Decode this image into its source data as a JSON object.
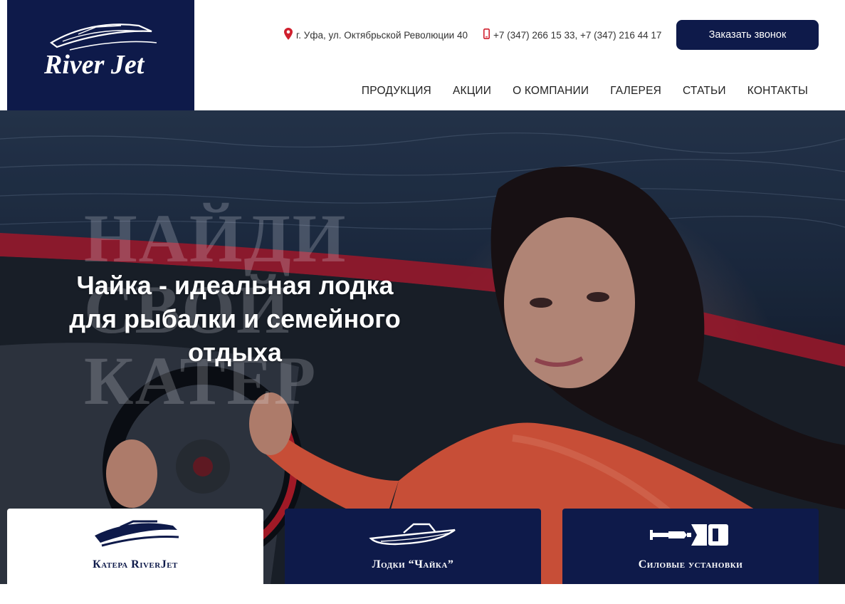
{
  "brand": {
    "name": "River Jet",
    "colors": {
      "navy": "#0e1a4a",
      "accent_red": "#d0202e",
      "white": "#ffffff"
    }
  },
  "header": {
    "address": "г. Уфа, ул. Октябрьской Революции 40",
    "phones": "+7 (347) 266 15 33, +7 (347) 216 44 17",
    "call_button": "Заказать звонок",
    "icons": {
      "address": "map-pin-icon",
      "phone": "phone-icon"
    }
  },
  "nav": {
    "items": [
      {
        "label": "ПРОДУКЦИЯ"
      },
      {
        "label": "АКЦИИ"
      },
      {
        "label": "О КОМПАНИИ"
      },
      {
        "label": "ГАЛЕРЕЯ"
      },
      {
        "label": "СТАТЬИ"
      },
      {
        "label": "КОНТАКТЫ"
      }
    ]
  },
  "hero": {
    "ghost_text": [
      "НАЙДИ",
      "СВОЙ",
      "КАТЕР"
    ],
    "headline": [
      "Чайка - идеальная лодка",
      "для рыбалки и семейного",
      "отдыха"
    ]
  },
  "categories": [
    {
      "label": "Катера RiverJet",
      "icon": "speedboat-icon",
      "active": true
    },
    {
      "label": "Лодки “Чайка”",
      "icon": "boat-icon",
      "active": false
    },
    {
      "label": "Силовые установки",
      "icon": "outboard-motor-icon",
      "active": false
    }
  ]
}
